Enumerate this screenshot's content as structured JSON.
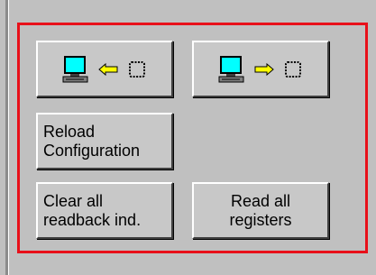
{
  "panel": {
    "buttons": {
      "write_to_device": {
        "icons": [
          "computer-icon",
          "arrow-left-icon",
          "chip-icon"
        ]
      },
      "read_from_device": {
        "icons": [
          "computer-icon",
          "arrow-right-icon",
          "chip-icon"
        ]
      },
      "reload_configuration": {
        "label": "Reload\nConfiguration"
      },
      "clear_readback": {
        "label": "Clear all\nreadback ind."
      },
      "read_all_registers": {
        "label": "Read all\nregisters"
      }
    },
    "highlight_color": "#e8101a",
    "arrow_color": "#ffff00",
    "screen_color": "#00ffff"
  }
}
